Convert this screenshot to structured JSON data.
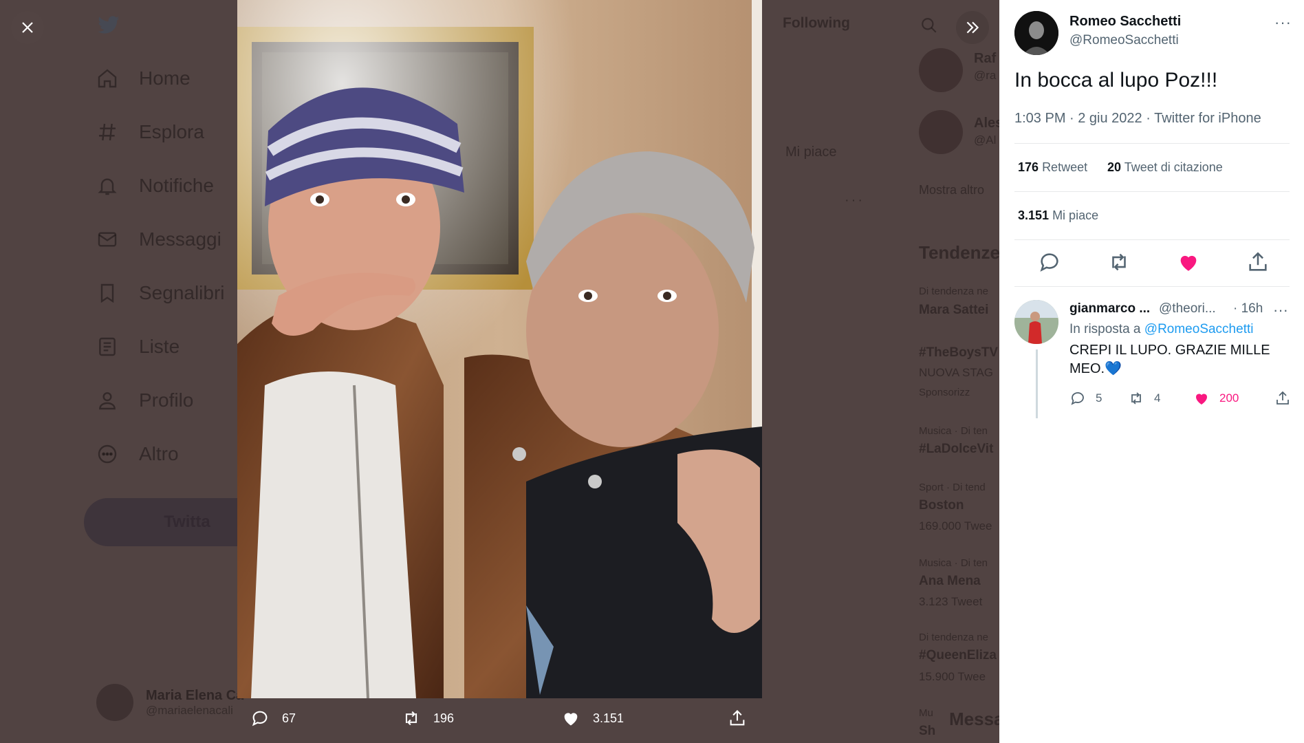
{
  "background": {
    "nav_items": [
      {
        "label": "Home",
        "icon": "home-icon"
      },
      {
        "label": "Esplora",
        "icon": "hashtag-icon"
      },
      {
        "label": "Notifiche",
        "icon": "bell-icon"
      },
      {
        "label": "Messaggi",
        "icon": "envelope-icon"
      },
      {
        "label": "Segnalibri",
        "icon": "bookmark-icon"
      },
      {
        "label": "Liste",
        "icon": "list-icon"
      },
      {
        "label": "Profilo",
        "icon": "person-icon"
      },
      {
        "label": "Altro",
        "icon": "more-circle-icon"
      }
    ],
    "tweet_button": "Twitta",
    "profile_name": "Maria Elena Ca",
    "profile_handle": "@mariaelenacali",
    "following_label": "Following",
    "mi_piace_tab": "Mi piace",
    "who_to_follow": [
      {
        "name": "Raf",
        "handle": "@ra"
      },
      {
        "name": "Ales",
        "handle": "@Al"
      }
    ],
    "show_more": "Mostra altro",
    "trends_title": "Tendenze",
    "trends": [
      {
        "context": "Di tendenza ne",
        "name": "Mara Sattei",
        "count": ""
      },
      {
        "context": "",
        "name": "#TheBoysTV",
        "count": "NUOVA STAG"
      },
      {
        "context": "Sponsorizz",
        "name": "",
        "count": ""
      },
      {
        "context": "Musica · Di ten",
        "name": "#LaDolceVit",
        "count": ""
      },
      {
        "context": "Sport · Di tend",
        "name": "Boston",
        "count": "169.000 Twee"
      },
      {
        "context": "Musica · Di ten",
        "name": "Ana Mena",
        "count": "3.123 Tweet"
      },
      {
        "context": "Di tendenza ne",
        "name": "#QueenEliza",
        "count": "15.900 Twee"
      },
      {
        "context": "Mu",
        "name": "Sh",
        "count": ""
      }
    ],
    "messages_label": "Messa"
  },
  "overlay": {
    "stats": [
      {
        "name": "reply",
        "icon": "reply-icon",
        "value": "67"
      },
      {
        "name": "retweet",
        "icon": "retweet-icon",
        "value": "196"
      },
      {
        "name": "like",
        "icon": "heart-icon",
        "value": "3.151"
      },
      {
        "name": "share",
        "icon": "share-icon",
        "value": ""
      }
    ]
  },
  "tweet": {
    "author_name": "Romeo Sacchetti",
    "author_handle": "@RomeoSacchetti",
    "text": "In bocca al lupo Poz!!!",
    "meta": "1:03 PM · 2 giu 2022 · Twitter for iPhone",
    "retweets": "176",
    "retweets_label": "Retweet",
    "quotes": "20",
    "quotes_label": "Tweet di citazione",
    "likes": "3.151",
    "likes_label": "Mi piace",
    "more": "···"
  },
  "reply": {
    "name": "gianmarco ...",
    "handle": "@theori...",
    "time": "· 16h",
    "reply_prefix": "In risposta a",
    "reply_to": "@RomeoSacchetti",
    "text": "CREPI IL LUPO. GRAZIE MILLE MEO.💙",
    "replies": "5",
    "retweets": "4",
    "likes": "200",
    "more": "···"
  },
  "colors": {
    "like_pink": "#f91880",
    "link_blue": "#1d9bf0",
    "overlay_bg": "#514342"
  }
}
